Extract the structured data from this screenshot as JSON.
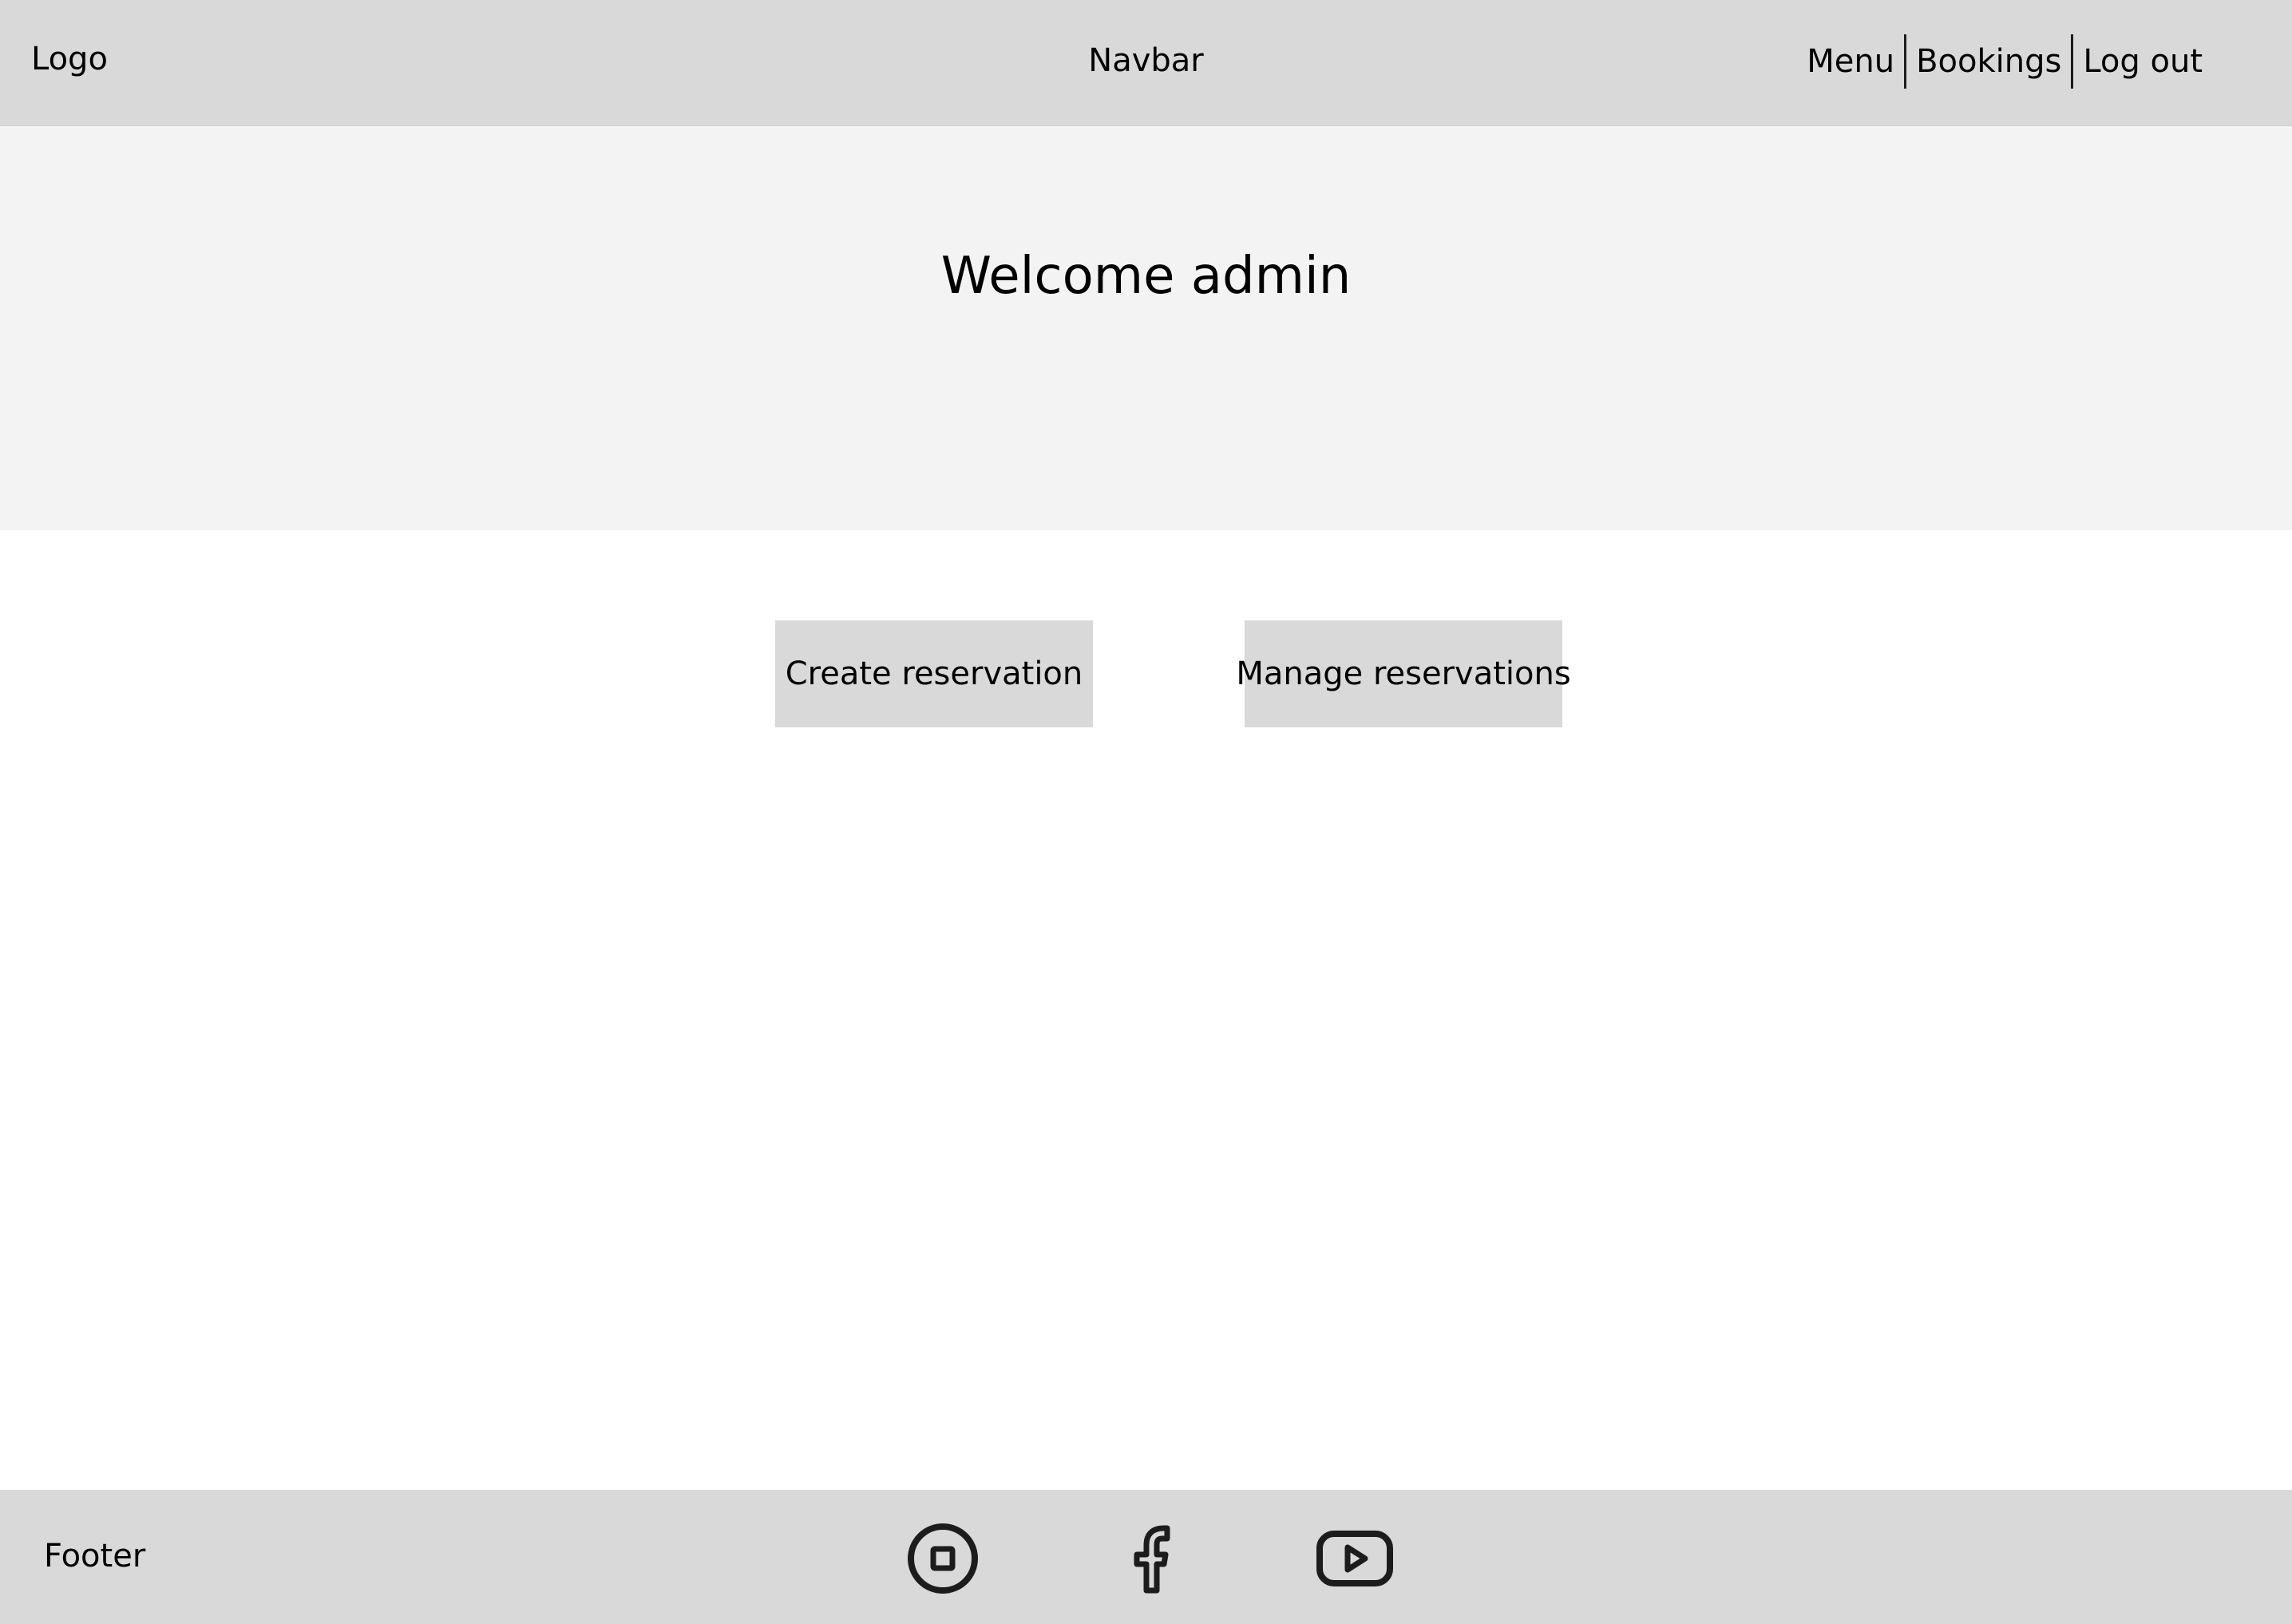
{
  "navbar": {
    "logo": "Logo",
    "center_label": "Navbar",
    "links": [
      "Menu",
      "Bookings",
      "Log out"
    ]
  },
  "hero": {
    "title": "Welcome admin"
  },
  "actions": {
    "create_label": "Create reservation",
    "manage_label": "Manage reservations"
  },
  "footer": {
    "label": "Footer",
    "social_icons": [
      "instagram-icon",
      "facebook-icon",
      "youtube-icon"
    ]
  },
  "colors": {
    "bar_gray": "#d9d9d9",
    "hero_bg": "#f3f3f3",
    "icon_stroke": "#1c1c1c"
  }
}
